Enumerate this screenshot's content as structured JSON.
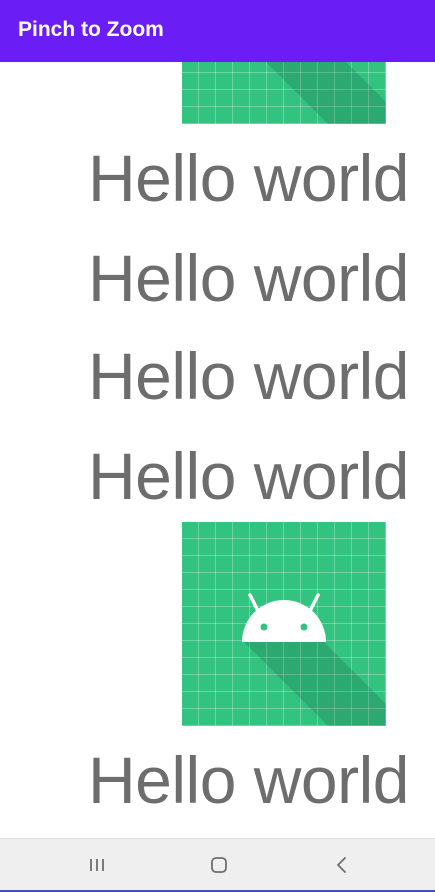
{
  "app_bar": {
    "title": "Pinch to Zoom",
    "color": "#6a1ef5"
  },
  "content": {
    "items": [
      {
        "type": "image",
        "icon": "android-logo-icon"
      },
      {
        "type": "text",
        "text": "Hello world"
      },
      {
        "type": "text",
        "text": "Hello world"
      },
      {
        "type": "text",
        "text": "Hello world"
      },
      {
        "type": "text",
        "text": "Hello world"
      },
      {
        "type": "image",
        "icon": "android-logo-icon"
      },
      {
        "type": "text",
        "text": "Hello world"
      }
    ],
    "tile_color": "#33c381",
    "text_color": "#6d6d6d"
  },
  "nav_bar": {
    "buttons": [
      {
        "name": "recent-apps",
        "icon": "recent-apps-icon"
      },
      {
        "name": "home",
        "icon": "home-icon"
      },
      {
        "name": "back",
        "icon": "back-icon"
      }
    ]
  }
}
